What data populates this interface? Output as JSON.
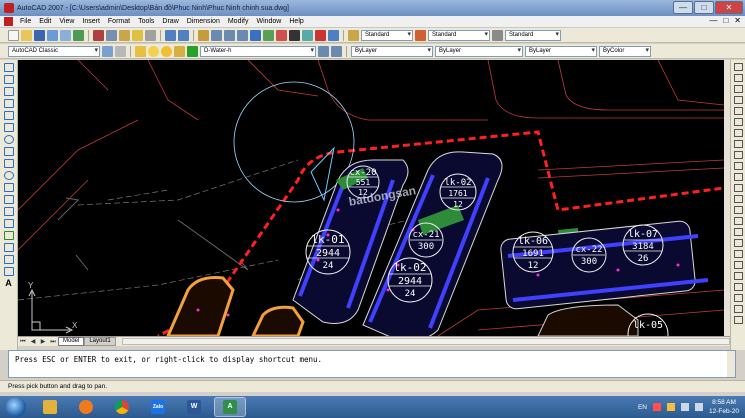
{
  "window": {
    "title": "AutoCAD 2007 - [C:\\Users\\admin\\Desktop\\Bản đồ\\Phuc Ninh\\Phuc Ninh chinh sua.dwg]",
    "min": "—",
    "max": "□",
    "close": "✕"
  },
  "menu": [
    "File",
    "Edit",
    "View",
    "Insert",
    "Format",
    "Tools",
    "Draw",
    "Dimension",
    "Modify",
    "Window",
    "Help"
  ],
  "styles_toolbar": {
    "text_style": "Standard",
    "dim_style": "Standard",
    "table_style": "Standard"
  },
  "workspace": "AutoCAD Classic",
  "layer": "D-Water-h",
  "properties": {
    "color": "ByLayer",
    "linetype": "ByLayer",
    "lineweight": "ByLayer",
    "plotstyle": "ByColor"
  },
  "drawing": {
    "labels": [
      {
        "code": "cx-20",
        "num": "551",
        "sub": "12"
      },
      {
        "code": "lk-02",
        "num": "1761",
        "sub": "12"
      },
      {
        "code": "cx-21",
        "num": "300",
        "sub": ""
      },
      {
        "code": "lk-01",
        "num": "2944",
        "sub": "24"
      },
      {
        "code": "lk-02",
        "num": "2944",
        "sub": "24"
      },
      {
        "code": "lk-06",
        "num": "1691",
        "sub": "12"
      },
      {
        "code": "cx-22",
        "num": "300",
        "sub": ""
      },
      {
        "code": "lk-07",
        "num": "3184",
        "sub": "26"
      },
      {
        "code": "lk-05",
        "num": "",
        "sub": ""
      }
    ],
    "watermark": "batdongsan",
    "ucs": {
      "x": "X",
      "y": "Y"
    }
  },
  "tabs": [
    "Model",
    "Layout1"
  ],
  "command_line": "Press ESC or ENTER to exit, or right-click to display shortcut menu.",
  "status_text": "Press pick button and drag to pan.",
  "taskbar": {
    "apps": [
      "Zalo",
      "W",
      "A"
    ],
    "lang": "EN",
    "time": "8:58 AM",
    "date": "12-Feb-20"
  }
}
